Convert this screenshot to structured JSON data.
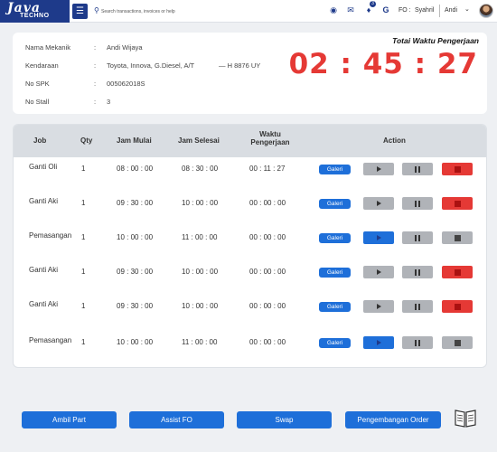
{
  "header": {
    "logo_text": "Java",
    "logo_subtext": "TECHNO",
    "search_placeholder": "Search transactions, invoices or help",
    "notification_count": "3",
    "fo_label": "FO :",
    "fo_name": "Syahril",
    "user_name": "Andi",
    "icons": [
      "globe-icon",
      "chat-icon",
      "bell-icon",
      "g-icon"
    ]
  },
  "info": {
    "rows": [
      {
        "label": "Nama Mekanik",
        "value": "Andi Wijaya"
      },
      {
        "label": "Kendaraan",
        "value": "Toyota, Innova, G.Diesel, A/T",
        "extra": "—    H 8876 UY"
      },
      {
        "label": "No SPK",
        "value": "005062018S"
      },
      {
        "label": "No Stall",
        "value": "3"
      }
    ],
    "total_title": "Totai Waktu Pengerjaan",
    "timer": "02 : 45 : 27"
  },
  "table": {
    "headers": {
      "job": "Job",
      "qty": "Qty",
      "start": "Jam Mulai",
      "end": "Jam Selesai",
      "duration_line1": "Waktu",
      "duration_line2": "Pengerjaan",
      "action": "Action"
    },
    "galeri_label": "Galeri",
    "rows": [
      {
        "job": "Ganti Oli",
        "qty": "1",
        "start": "08 : 00 : 00",
        "end": "08 : 30 : 00",
        "duration": "00 : 11 : 27",
        "state": "running"
      },
      {
        "job": "Ganti Aki",
        "qty": "1",
        "start": "09 : 30 : 00",
        "end": "10 : 00 : 00",
        "duration": "00 : 00 : 00",
        "state": "running"
      },
      {
        "job": "Pemasangan",
        "qty": "1",
        "start": "10 : 00 : 00",
        "end": "11 : 00 : 00",
        "duration": "00 : 00 : 00",
        "state": "idle"
      },
      {
        "job": "Ganti Aki",
        "qty": "1",
        "start": "09 : 30 : 00",
        "end": "10 : 00 : 00",
        "duration": "00 : 00 : 00",
        "state": "running"
      },
      {
        "job": "Ganti Aki",
        "qty": "1",
        "start": "09 : 30 : 00",
        "end": "10 : 00 : 00",
        "duration": "00 : 00 : 00",
        "state": "running"
      },
      {
        "job": "Pemasangan",
        "qty": "1",
        "start": "10 : 00 : 00",
        "end": "11 : 00 : 00",
        "duration": "00 : 00 : 00",
        "state": "idle"
      }
    ]
  },
  "footer": {
    "buttons": [
      "Ambil Part",
      "Assist FO",
      "Swap",
      "Pengembangan Order"
    ],
    "manual_icon": "book-icon"
  },
  "colors": {
    "brand": "#1e3a8a",
    "primary_button": "#1e6fd9",
    "stop_red": "#e53935",
    "disabled_grey": "#b0b3b8"
  }
}
